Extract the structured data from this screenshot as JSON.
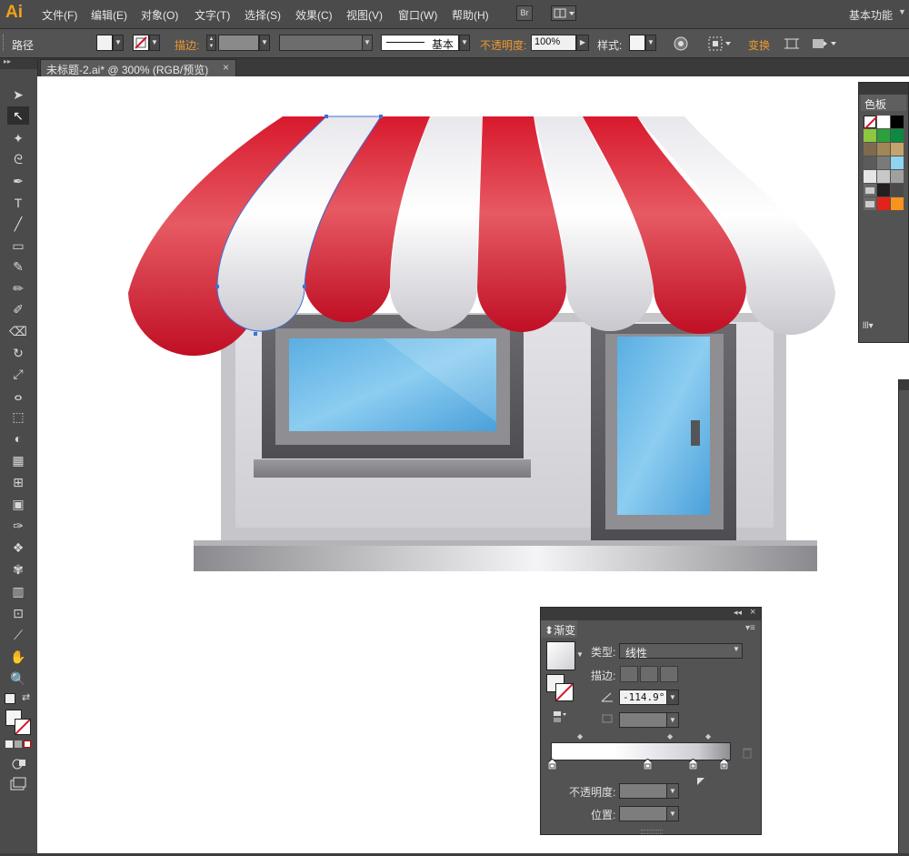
{
  "app": {
    "logo": "Ai"
  },
  "menu": [
    "文件(F)",
    "编辑(E)",
    "对象(O)",
    "文字(T)",
    "选择(S)",
    "效果(C)",
    "视图(V)",
    "窗口(W)",
    "帮助(H)"
  ],
  "bridge_button": "Br",
  "workspace": "基本功能",
  "control": {
    "object_type": "路径",
    "stroke_label": "描边:",
    "stroke_style": "基本",
    "opacity_label": "不透明度:",
    "opacity_value": "100%",
    "style_label": "样式:",
    "transform_label": "变换"
  },
  "document_tab": {
    "title": "未标题-2.ai* @ 300% (RGB/预览)",
    "close": "×"
  },
  "swatches_panel": {
    "title": "色板"
  },
  "gradient_panel": {
    "title": "渐变",
    "type_label": "类型:",
    "type_value": "线性",
    "stroke_label": "描边:",
    "angle_value": "-114.9°",
    "opacity_label": "不透明度:",
    "location_label": "位置:"
  },
  "icons": [
    "selection-tool",
    "direct-selection-tool",
    "magic-wand",
    "lasso",
    "pen",
    "type",
    "line",
    "rectangle",
    "paintbrush",
    "pencil",
    "blob-brush",
    "eraser",
    "rotate",
    "scale",
    "warp",
    "free-transform",
    "shape-builder",
    "perspective-grid",
    "mesh",
    "gradient",
    "eyedropper",
    "blend",
    "symbol-sprayer",
    "column-graph",
    "artboard",
    "slice",
    "hand",
    "zoom"
  ],
  "colors": {
    "awning_red": "#d7192e",
    "awning_white": "#f3f3f5",
    "glass_blue": "#6cb6e4",
    "frame_gray": "#5e5e62",
    "accent_orange": "#ec9a2d"
  }
}
